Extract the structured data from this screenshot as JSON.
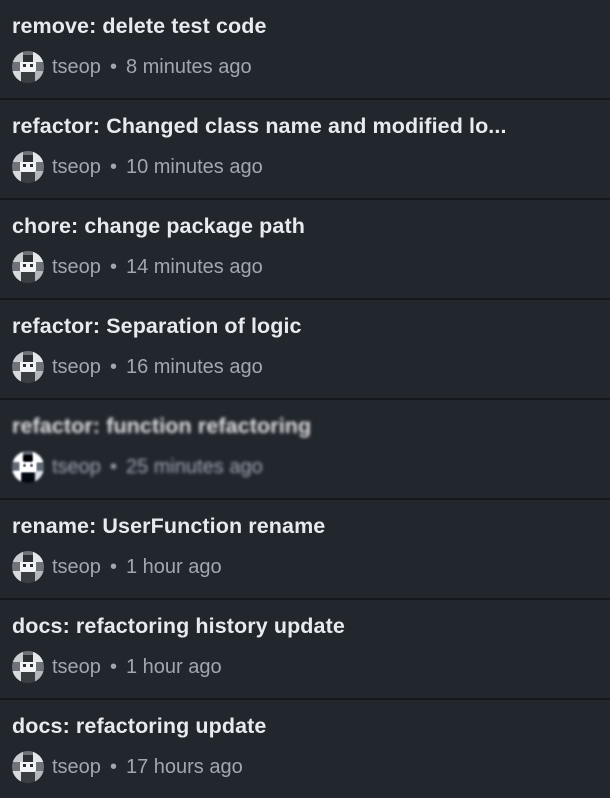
{
  "commits": [
    {
      "title": "remove: delete test code",
      "author": "tseop",
      "separator": "•",
      "time": "8 minutes ago",
      "avatar_icon": "user-avatar-icon",
      "obscured": false
    },
    {
      "title": "refactor: Changed class name and modified lo...",
      "author": "tseop",
      "separator": "•",
      "time": "10 minutes ago",
      "avatar_icon": "user-avatar-icon",
      "obscured": false
    },
    {
      "title": "chore: change package path",
      "author": "tseop",
      "separator": "•",
      "time": "14 minutes ago",
      "avatar_icon": "user-avatar-icon",
      "obscured": false
    },
    {
      "title": "refactor: Separation of logic",
      "author": "tseop",
      "separator": "•",
      "time": "16 minutes ago",
      "avatar_icon": "user-avatar-icon",
      "obscured": false
    },
    {
      "title": "refactor: function refactoring",
      "author": "tseop",
      "separator": "•",
      "time": "25 minutes ago",
      "avatar_icon": "user-avatar-icon",
      "obscured": true
    },
    {
      "title": "rename: UserFunction rename",
      "author": "tseop",
      "separator": "•",
      "time": "1 hour ago",
      "avatar_icon": "user-avatar-icon",
      "obscured": false
    },
    {
      "title": "docs: refactoring history update",
      "author": "tseop",
      "separator": "•",
      "time": "1 hour ago",
      "avatar_icon": "user-avatar-icon",
      "obscured": false
    },
    {
      "title": "docs: refactoring update",
      "author": "tseop",
      "separator": "•",
      "time": "17 hours ago",
      "avatar_icon": "user-avatar-icon",
      "obscured": false
    }
  ],
  "colors": {
    "background": "#22262d",
    "divider": "#15181c",
    "title_text": "#e8eaed",
    "meta_text": "#a2a7af"
  }
}
